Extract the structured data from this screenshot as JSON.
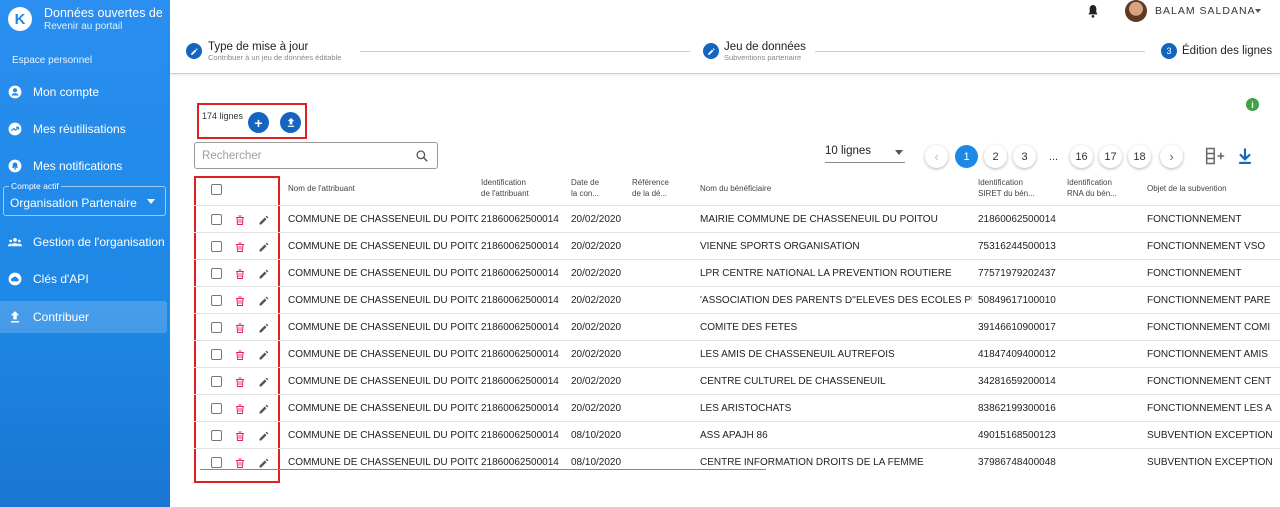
{
  "app": {
    "title": "Données ouvertes de r...",
    "subtitle": "Revenir au portail",
    "logo_letter": "K"
  },
  "sidebar": {
    "section_label": "Espace personnel",
    "items_top": [
      {
        "label": "Mon compte",
        "icon": "account-circle-icon"
      },
      {
        "label": "Mes réutilisations",
        "icon": "trending-up-icon"
      },
      {
        "label": "Mes notifications",
        "icon": "notifications-icon"
      }
    ],
    "account": {
      "label": "Compte actif",
      "value": "Organisation Partenaire"
    },
    "items_bottom": [
      {
        "label": "Gestion de l'organisation",
        "icon": "group-icon"
      },
      {
        "label": "Clés d'API",
        "icon": "cloud-icon"
      },
      {
        "label": "Contribuer",
        "icon": "upload-icon",
        "active": true
      }
    ]
  },
  "topbar": {
    "username": "BALAM SALDANA"
  },
  "stepper": {
    "steps": [
      {
        "title": "Type de mise à jour",
        "subtitle": "Contribuer à un jeu de données éditable",
        "icon": "pencil-icon"
      },
      {
        "title": "Jeu de données",
        "subtitle": "Subventions partenaire",
        "icon": "pencil-icon"
      },
      {
        "number": "3",
        "title": "Édition des lignes",
        "subtitle": ""
      }
    ]
  },
  "toolbar": {
    "rows_count": "174 lignes",
    "add_icon": "+",
    "search_placeholder": "Rechercher",
    "rows_per_page": "10 lignes",
    "pages": [
      "1",
      "2",
      "3",
      "...",
      "16",
      "17",
      "18"
    ],
    "current_page": "1"
  },
  "table": {
    "headers": [
      "Nom de l'attribuant",
      "Identification de l'attribuant",
      "Date de la con...",
      "Référence de la dé...",
      "Nom du bénéficiaire",
      "Identification SIRET du bén...",
      "Identification RNA du bén...",
      "Objet de la subvention"
    ],
    "headers_wrapped": [
      [
        "Nom de l'attribuant"
      ],
      [
        "Identification",
        "de l'attribuant"
      ],
      [
        "Date de",
        "la con..."
      ],
      [
        "Référence",
        "de la dé..."
      ],
      [
        "Nom du bénéficiaire"
      ],
      [
        "Identification",
        "SIRET du bén..."
      ],
      [
        "Identification",
        "RNA du bén..."
      ],
      [
        "Objet de la subvention"
      ]
    ],
    "rows": [
      [
        "COMMUNE DE CHASSENEUIL DU POITOU",
        "21860062500014",
        "20/02/2020",
        "",
        "MAIRIE COMMUNE DE CHASSENEUIL DU POITOU",
        "21860062500014",
        "",
        "FONCTIONNEMENT"
      ],
      [
        "COMMUNE DE CHASSENEUIL DU POITOU",
        "21860062500014",
        "20/02/2020",
        "",
        "VIENNE SPORTS ORGANISATION",
        "75316244500013",
        "",
        "FONCTIONNEMENT VSO"
      ],
      [
        "COMMUNE DE CHASSENEUIL DU POITOU",
        "21860062500014",
        "20/02/2020",
        "",
        "LPR CENTRE NATIONAL LA PREVENTION ROUTIERE",
        "77571979202437",
        "",
        "FONCTIONNEMENT"
      ],
      [
        "COMMUNE DE CHASSENEUIL DU POITOU",
        "21860062500014",
        "20/02/2020",
        "",
        "'ASSOCIATION DES PARENTS D''ELEVES DES ECOLES PUBL...",
        "50849617100010",
        "",
        "FONCTIONNEMENT PARE"
      ],
      [
        "COMMUNE DE CHASSENEUIL DU POITOU",
        "21860062500014",
        "20/02/2020",
        "",
        "COMITE DES FETES",
        "39146610900017",
        "",
        "FONCTIONNEMENT COMI"
      ],
      [
        "COMMUNE DE CHASSENEUIL DU POITOU",
        "21860062500014",
        "20/02/2020",
        "",
        "LES AMIS DE CHASSENEUIL AUTREFOIS",
        "41847409400012",
        "",
        "FONCTIONNEMENT AMIS"
      ],
      [
        "COMMUNE DE CHASSENEUIL DU POITOU",
        "21860062500014",
        "20/02/2020",
        "",
        "CENTRE CULTUREL DE CHASSENEUIL",
        "34281659200014",
        "",
        "FONCTIONNEMENT CENT"
      ],
      [
        "COMMUNE DE CHASSENEUIL DU POITOU",
        "21860062500014",
        "20/02/2020",
        "",
        "LES ARISTOCHATS",
        "83862199300016",
        "",
        "FONCTIONNEMENT LES A"
      ],
      [
        "COMMUNE DE CHASSENEUIL DU POITOU",
        "21860062500014",
        "08/10/2020",
        "",
        "ASS APAJH 86",
        "49015168500123",
        "",
        "SUBVENTION EXCEPTION"
      ],
      [
        "COMMUNE DE CHASSENEUIL DU POITOU",
        "21860062500014",
        "08/10/2020",
        "",
        "CENTRE INFORMATION DROITS DE LA FEMME",
        "37986748400048",
        "",
        "SUBVENTION EXCEPTION"
      ]
    ]
  },
  "colors": {
    "primary": "#1565c0",
    "sidebar": "#1e88e5",
    "highlight_box": "#e02020",
    "trash": "#e91e63",
    "info": "#43a047"
  }
}
